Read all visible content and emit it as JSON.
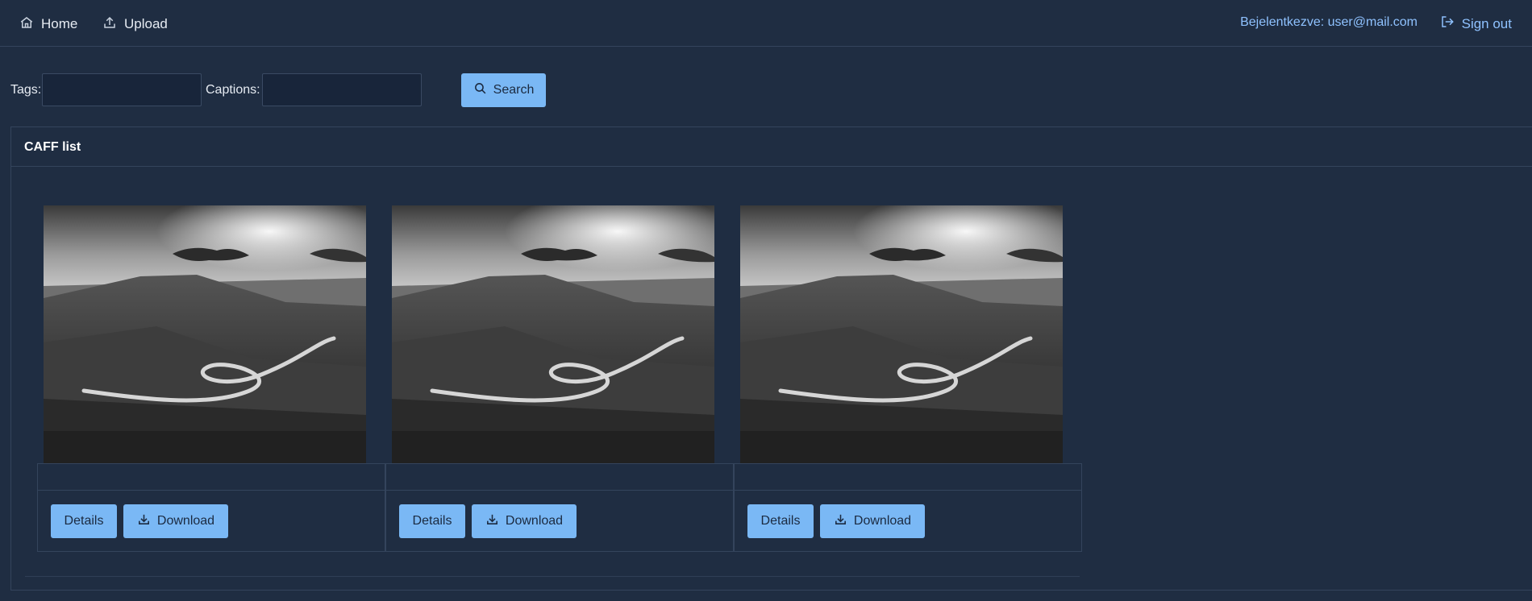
{
  "nav": {
    "home_label": "Home",
    "upload_label": "Upload",
    "user_label": "Bejelentkezve: user@mail.com",
    "signout_label": "Sign out"
  },
  "filters": {
    "tags_label": "Tags:",
    "tags_value": "",
    "captions_label": "Captions:",
    "captions_value": "",
    "search_label": "Search"
  },
  "panel": {
    "title": "CAFF list"
  },
  "cards": [
    {
      "details_label": "Details",
      "download_label": "Download"
    },
    {
      "details_label": "Details",
      "download_label": "Download"
    },
    {
      "details_label": "Details",
      "download_label": "Download"
    }
  ],
  "colors": {
    "background": "#1f2d42",
    "accent": "#7ab8f5",
    "link": "#8fc2ff"
  },
  "icons": [
    "home-icon",
    "upload-icon",
    "sign-out-icon",
    "search-icon",
    "download-icon"
  ]
}
